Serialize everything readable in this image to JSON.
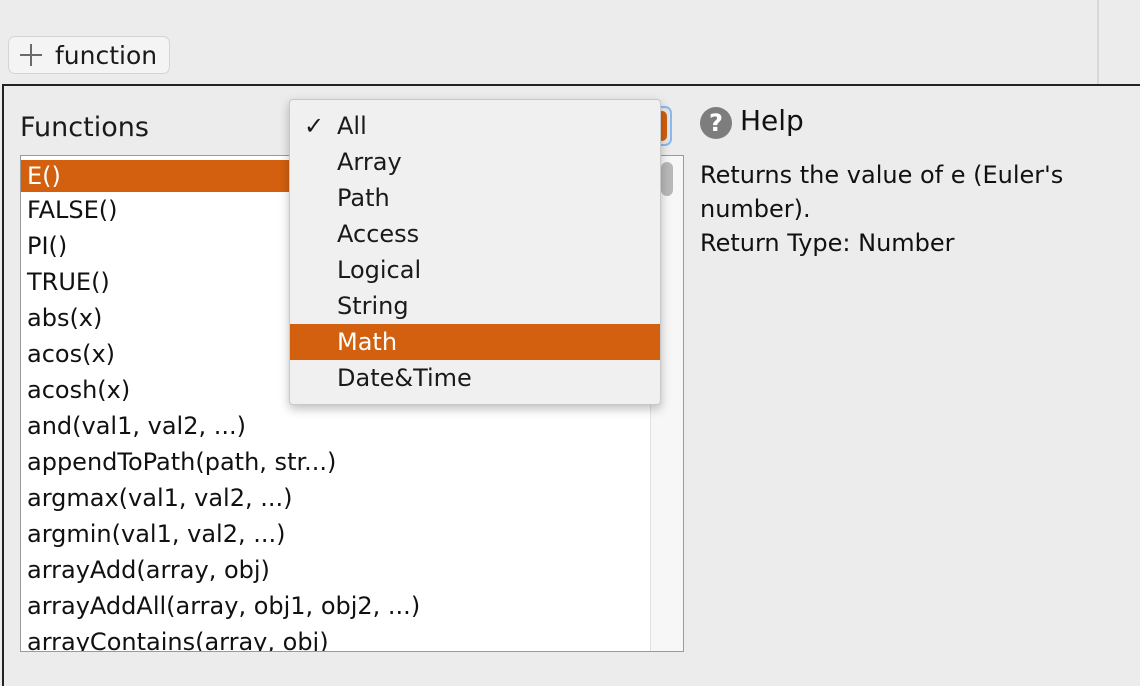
{
  "toolbar": {
    "add_function_label": "function"
  },
  "functions_panel": {
    "title": "Functions",
    "items": [
      "E()",
      "FALSE()",
      "PI()",
      "TRUE()",
      "abs(x)",
      "acos(x)",
      "acosh(x)",
      "and(val1, val2, ...)",
      "appendToPath(path, str...)",
      "argmax(val1, val2, ...)",
      "argmin(val1, val2, ...)",
      "arrayAdd(array, obj)",
      "arrayAddAll(array, obj1, obj2, ...)",
      "arrayContains(array, obj)"
    ],
    "selected_index": 0
  },
  "category_dropdown": {
    "checkmark": "✓",
    "checked_option": "All",
    "highlighted_option": "Math",
    "options": [
      "All",
      "Array",
      "Path",
      "Access",
      "Logical",
      "String",
      "Math",
      "Date&Time"
    ]
  },
  "help": {
    "icon_glyph": "?",
    "title": "Help",
    "description_line1": "Returns the value of e (Euler's",
    "description_line2": "number).",
    "return_type": "Return Type: Number"
  },
  "colors": {
    "accent": "#d2600f",
    "focus_ring": "#8ab8f0"
  }
}
